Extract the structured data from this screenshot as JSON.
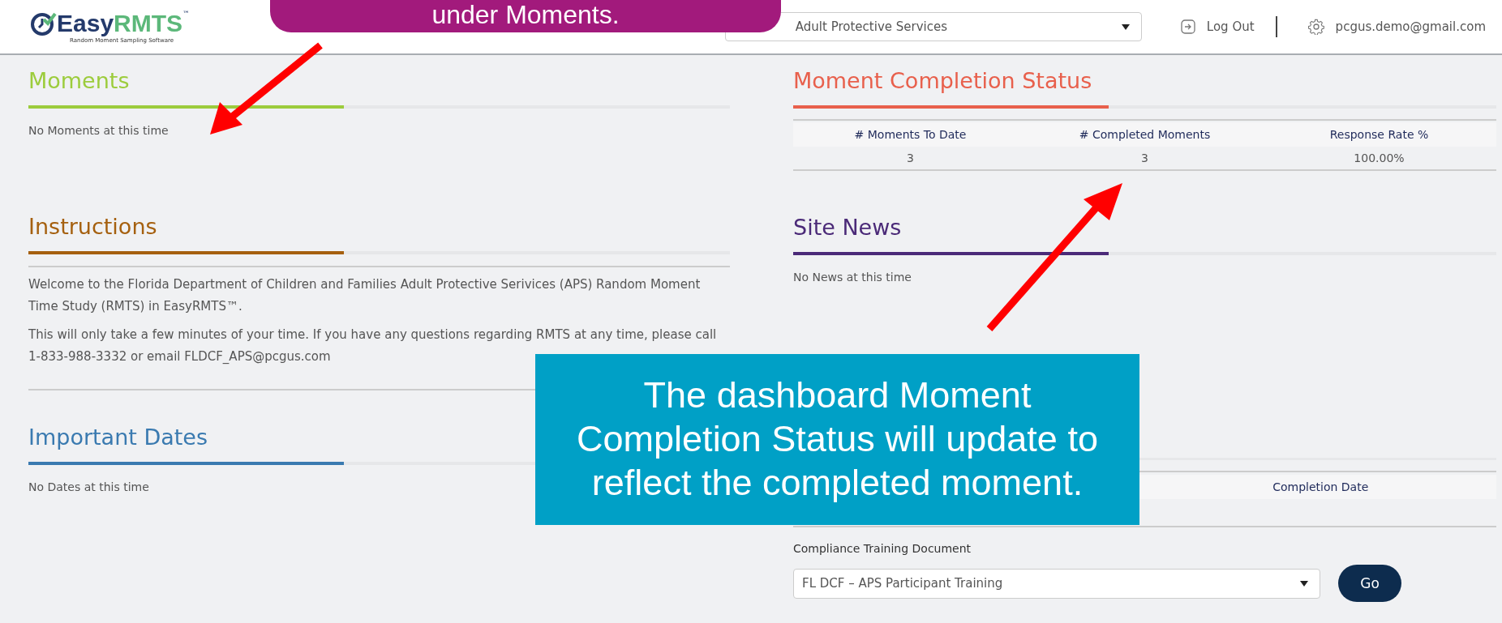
{
  "header": {
    "logo": {
      "word_part1": "Easy",
      "word_part2": "RMTS",
      "trademark": "™",
      "tagline": "Random Moment Sampling Software"
    },
    "program_select": {
      "value": "Adult Protective Services"
    },
    "logout": "Log Out",
    "user_email": "pcgus.demo@gmail.com"
  },
  "left_sections": [
    {
      "kind": "plain",
      "title": "Moments",
      "color": "#9ccc3c",
      "paragraphs": [
        "No Moments at this time"
      ]
    },
    {
      "kind": "ruled",
      "title": "Instructions",
      "color": "#a5600f",
      "paragraphs": [
        "Welcome to the Florida Department of Children and Families Adult Protective Serivices (APS) Random Moment Time Study (RMTS) in EasyRMTS™.",
        "This will only take a few minutes of your time. If you have any questions regarding RMTS at any time, please call 1-833-988-3332 or email FLDCF_APS@pcgus.com"
      ]
    },
    {
      "kind": "plain",
      "title": "Important Dates",
      "color": "#3a7ab0",
      "paragraphs": [
        "No Dates at this time"
      ]
    }
  ],
  "completion_status": {
    "title": "Moment Completion Status",
    "color": "#e8604c",
    "columns": [
      "# Moments To Date",
      "# Completed Moments",
      "Response Rate %"
    ],
    "rows": [
      [
        "3",
        "3",
        "100.00%"
      ]
    ]
  },
  "site_news": {
    "title": "Site News",
    "color": "#4b2a78",
    "paragraphs": [
      "No News at this time"
    ]
  },
  "moments_table": {
    "columns": [
      "Completion Date"
    ]
  },
  "compliance": {
    "label": "Compliance Training Document",
    "value": "FL DCF – APS Participant Training",
    "button": "Go"
  },
  "callouts": [
    {
      "text": "under Moments.",
      "color": "#a21a7c"
    },
    {
      "text": "The dashboard Moment Completion Status will update to reflect the completed moment.",
      "color": "#00a0c6"
    }
  ]
}
